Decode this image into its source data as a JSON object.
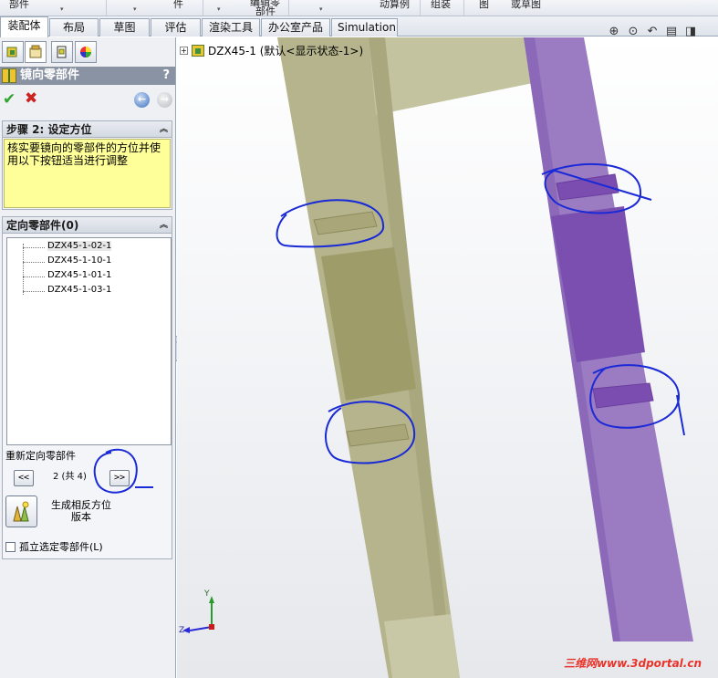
{
  "top_strip": {
    "items": [
      "部件",
      "件",
      "编辑零",
      "部件",
      "动算例",
      "组装",
      "图",
      "或草图"
    ]
  },
  "tabs": [
    "装配体",
    "布局",
    "草图",
    "评估",
    "渲染工具",
    "办公室产品",
    "Simulation"
  ],
  "active_tab": "装配体",
  "property_manager": {
    "title": "镜向零部件",
    "help": "?",
    "ok_icon": "checkmark-icon",
    "cancel_icon": "close-icon",
    "back_icon": "arrow-left-icon",
    "forward_icon": "arrow-right-icon"
  },
  "step_group": {
    "header": "步骤 2: 设定方位",
    "message": "核实要镜向的零部件的方位并使用以下按钮适当进行调整"
  },
  "orient_group": {
    "header": "定向零部件(0)",
    "components": [
      "DZX45-1-02-1",
      "DZX45-1-10-1",
      "DZX45-1-01-1",
      "DZX45-1-03-1"
    ],
    "reorient_label": "重新定向零部件",
    "prev_label": "<<",
    "next_label": ">>",
    "page_count": "2 (共 4)",
    "generate_label_1": "生成相反方位",
    "generate_label_2": "版本",
    "isolate_label": "孤立选定零部件(L)"
  },
  "viewport": {
    "tree_root": "DZX45-1  (默认<显示状态-1>)",
    "plus": "+",
    "axis_y": "Y",
    "axis_z": "Z",
    "watermark": "三维网www.3dportal.cn",
    "view_tools": [
      "zoom-to-fit-icon",
      "zoom-area-icon",
      "previous-view-icon",
      "section-view-icon",
      "view-orientation-icon"
    ],
    "colors": {
      "left_part": "#c9c8a0",
      "right_part": "#9d7cc4",
      "annotation": "#1a2ad6"
    }
  },
  "splitter_arrows": "‹‹‹"
}
